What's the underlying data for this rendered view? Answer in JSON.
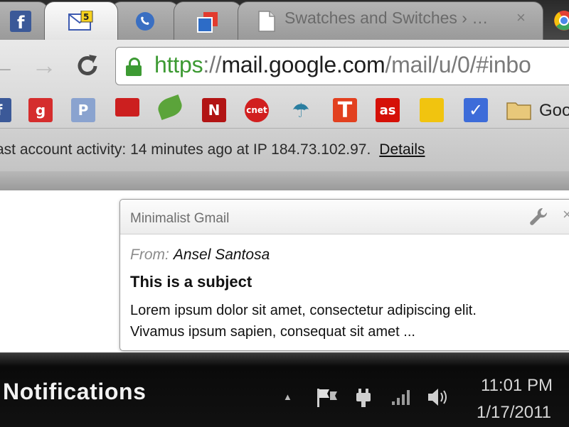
{
  "browser": {
    "tabs": [
      {
        "icon": "facebook-icon"
      },
      {
        "icon": "gmail-notifier-icon",
        "active": true
      },
      {
        "icon": "phone-icon"
      },
      {
        "icon": "app-icon"
      },
      {
        "icon": "document-icon",
        "title": "Swatches and Switches › …"
      }
    ],
    "close_glyph": "×",
    "url": {
      "scheme": "https",
      "sep": "://",
      "host": "mail.google.com",
      "path": "/mail/u/0/#inbo"
    },
    "bookmarks": [
      {
        "icon": "facebook-bookmark-icon",
        "glyph": "f",
        "color": "#3b5998"
      },
      {
        "icon": "grooveshark-bookmark-icon",
        "glyph": "g",
        "color": "#d52d2d"
      },
      {
        "icon": "pandora-bookmark-icon",
        "glyph": "P",
        "color": "#8aa3cf"
      },
      {
        "icon": "pocket-bookmark-icon",
        "glyph": "",
        "color": "#cc1f1f"
      },
      {
        "icon": "leaf-bookmark-icon",
        "glyph": "",
        "color": "#5ba43a"
      },
      {
        "icon": "netflix-bookmark-icon",
        "glyph": "N",
        "color": "#b21414"
      },
      {
        "icon": "cnet-bookmark-icon",
        "glyph": "cnet",
        "color": "#d11f1f"
      },
      {
        "icon": "tunein-bookmark-icon",
        "glyph": "T",
        "color": "#2a7ea0"
      },
      {
        "icon": "t-bookmark-icon",
        "glyph": "T",
        "color": "#e2401f"
      },
      {
        "icon": "lastfm-bookmark-icon",
        "glyph": "as",
        "color": "#d51007"
      },
      {
        "icon": "sticky-bookmark-icon",
        "glyph": "",
        "color": "#f1c40f"
      },
      {
        "icon": "check-bookmark-icon",
        "glyph": "✓",
        "color": "#3d6cd9"
      }
    ],
    "bookmark_folder_label": "Goo"
  },
  "activity": {
    "text": "ast account activity: 14 minutes ago at IP 184.73.102.97.",
    "link": "Details"
  },
  "notification": {
    "app": "Minimalist Gmail",
    "from_label": "From:",
    "from_name": "Ansel Santosa",
    "subject": "This is a subject",
    "body_lines": [
      "Lorem ipsum dolor sit amet, consectetur adipiscing elit.",
      "Vivamus ipsum sapien, consequat sit amet ..."
    ],
    "close_glyph": "×"
  },
  "taskbar": {
    "label": "Notifications",
    "show_hidden_glyph": "▲",
    "time": "11:01 PM",
    "date": "1/17/2011"
  }
}
